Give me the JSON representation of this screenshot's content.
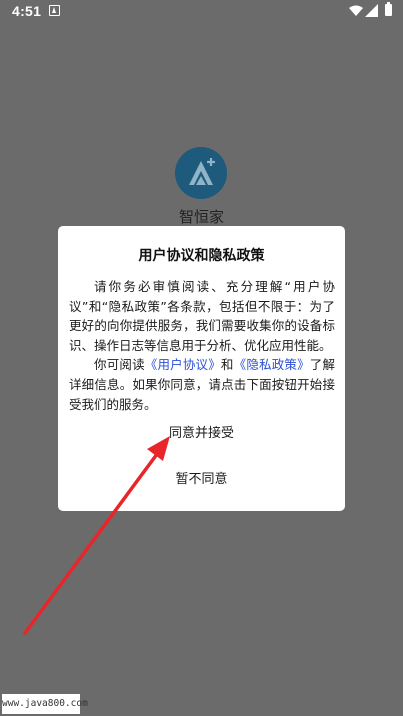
{
  "status_bar": {
    "time": "4:51"
  },
  "app": {
    "name": "智恒家",
    "logo_color": "#1d5a7c"
  },
  "dialog": {
    "title": "用户协议和隐私政策",
    "para1": "请你务必审慎阅读、充分理解“用户协议”和“隐私政策”各条款，包括但不限于：为了更好的向你提供服务，我们需要收集你的设备标识、操作日志等信息用于分析、优化应用性能。",
    "para2_prefix": "你可阅读",
    "link_user_agreement": "《用户协议》",
    "para2_and": "和",
    "link_privacy_policy": "《隐私政策》",
    "para2_suffix": "了解详细信息。如果你同意，请点击下面按钮开始接受我们的服务。",
    "accept_label": "同意并接受",
    "decline_label": "暂不同意",
    "link_color": "#2b4fd6"
  },
  "annotation": {
    "arrow_color": "#e8262a"
  },
  "watermark": {
    "text": "www.java800.com"
  }
}
